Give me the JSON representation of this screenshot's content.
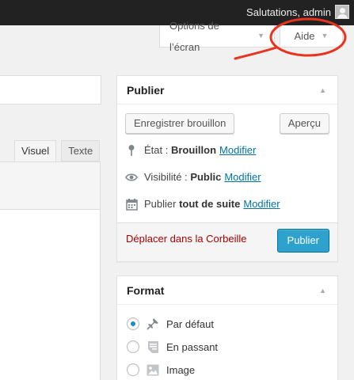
{
  "admin_bar": {
    "greeting": "Salutations, admin",
    "avatar_icon": "avatar-icon"
  },
  "screen_meta": {
    "screen_options_label": "Options de l’écran",
    "help_label": "Aide",
    "arrow_icon": "triangle-down-icon"
  },
  "editor": {
    "tabs": [
      {
        "label": "Visuel"
      },
      {
        "label": "Texte"
      }
    ]
  },
  "publish_box": {
    "title": "Publier",
    "save_draft_label": "Enregistrer brouillon",
    "preview_label": "Aperçu",
    "status": {
      "label": "État :",
      "value": "Brouillon",
      "link": "Modifier",
      "icon": "pin-icon"
    },
    "visibility": {
      "label": "Visibilité :",
      "value": "Public",
      "link": "Modifier",
      "icon": "eye-icon"
    },
    "schedule": {
      "label": "Publier",
      "value": "tout de suite",
      "link": "Modifier",
      "icon": "calendar-icon"
    },
    "trash_label": "Déplacer dans la Corbeille",
    "publish_label": "Publier"
  },
  "format_box": {
    "title": "Format",
    "options": [
      {
        "label": "Par défaut",
        "icon": "pushpin-icon",
        "checked": true
      },
      {
        "label": "En passant",
        "icon": "aside-icon",
        "checked": false
      },
      {
        "label": "Image",
        "icon": "image-icon",
        "checked": false
      }
    ]
  },
  "colors": {
    "admin_bar_bg": "#222222",
    "link": "#0074a2",
    "primary_button": "#2ea2cc",
    "trash": "#aa0000",
    "annotation": "#e8341c"
  }
}
